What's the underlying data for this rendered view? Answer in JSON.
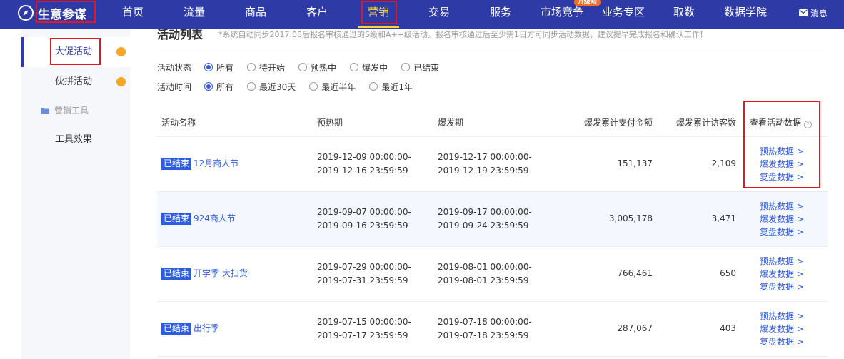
{
  "header": {
    "brand": "生意参谋",
    "nav": [
      {
        "label": "首页",
        "active": false
      },
      {
        "label": "流量",
        "active": false
      },
      {
        "label": "商品",
        "active": false
      },
      {
        "label": "客户",
        "active": false
      },
      {
        "label": "营销",
        "active": true
      },
      {
        "label": "交易",
        "active": false
      },
      {
        "label": "服务",
        "active": false
      },
      {
        "label": "市场竞争",
        "active": false
      },
      {
        "label": "业务专区",
        "active": false
      },
      {
        "label": "取数",
        "active": false
      },
      {
        "label": "数据学院",
        "active": false
      }
    ],
    "upgrade_badge": "升级啦",
    "message": "消息"
  },
  "sidebar": {
    "items": [
      {
        "label": "大促活动",
        "active": true
      },
      {
        "label": "伙拼活动",
        "active": false
      }
    ],
    "group_label": "营销工具",
    "tool_item": "工具效果"
  },
  "main": {
    "title": "活动列表",
    "note": "*系统自动同步2017.08后报名审核通过的S级和A++级活动。报名审核通过后至少需1日方可同步活动数据，建议提早完成报名和确认工作！",
    "filters": {
      "status": {
        "label": "活动状态",
        "options": [
          "所有",
          "待开始",
          "预热中",
          "爆发中",
          "已结束"
        ],
        "selected": 0
      },
      "time": {
        "label": "活动时间",
        "options": [
          "所有",
          "最近30天",
          "最近半年",
          "最近1年"
        ],
        "selected": 0
      }
    },
    "table": {
      "headers": {
        "name": "活动名称",
        "preheat": "预热期",
        "burst": "爆发期",
        "pay_amount": "爆发累计支付金额",
        "visitors": "爆发累计访客数",
        "view_data": "查看活动数据"
      },
      "link_labels": [
        "预热数据 >",
        "爆发数据 >",
        "复盘数据 >"
      ],
      "rows": [
        {
          "status": "已结束",
          "name": "12月商人节",
          "preheat": [
            "2019-12-09 00:00:00-",
            "2019-12-16 23:59:59"
          ],
          "burst": [
            "2019-12-17 00:00:00-",
            "2019-12-19 23:59:59"
          ],
          "pay_amount": "151,137",
          "visitors": "2,109"
        },
        {
          "status": "已结束",
          "name": "924商人节",
          "preheat": [
            "2019-09-07 00:00:00-",
            "2019-09-16 23:59:59"
          ],
          "burst": [
            "2019-09-17 00:00:00-",
            "2019-09-24 23:59:59"
          ],
          "pay_amount": "3,005,178",
          "visitors": "3,471"
        },
        {
          "status": "已结束",
          "name": "开学季 大扫货",
          "preheat": [
            "2019-07-29 00:00:00-",
            "2019-07-31 23:59:59"
          ],
          "burst": [
            "2019-08-01 00:00:00-",
            "2019-08-01 23:59:59"
          ],
          "pay_amount": "766,461",
          "visitors": "650"
        },
        {
          "status": "已结束",
          "name": "出行季",
          "preheat": [
            "2019-07-15 00:00:00-",
            "2019-07-17 23:59:59"
          ],
          "burst": [
            "2019-07-18 00:00:00-",
            "2019-07-18 23:59:59"
          ],
          "pay_amount": "287,067",
          "visitors": "403"
        }
      ]
    }
  },
  "colors": {
    "topbar": "#2e3ba6",
    "active_nav": "#ffd23a",
    "link": "#2e5be0",
    "highlight_box": "#e8151b",
    "sidebar_dot": "#f5a623"
  }
}
